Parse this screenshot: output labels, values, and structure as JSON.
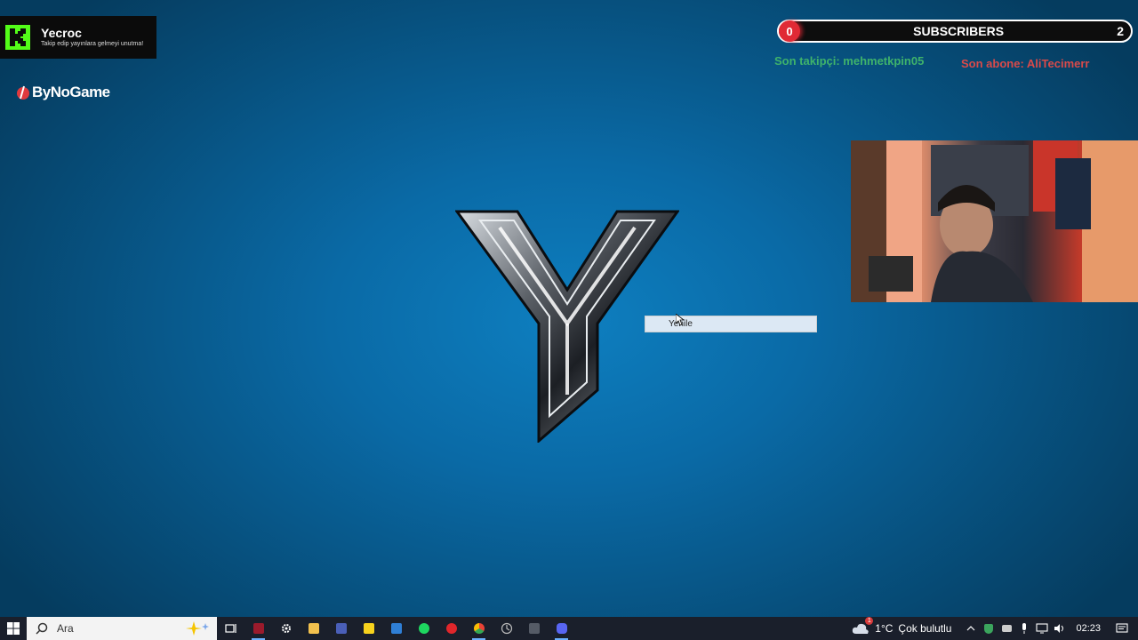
{
  "overlay": {
    "kick_name": "Yecroc",
    "kick_sub": "Takip edip yayınlara gelmeyi unutma!",
    "sponsor": "ByNoGame",
    "subs_current": "0",
    "subs_label": "SUBSCRIBERS",
    "subs_goal": "2",
    "last_follower": "Son takipçi: mehmetkpin05",
    "last_subscriber": "Son abone: AliTecimerr",
    "accent_kick": "#53fc18",
    "accent_red": "#e02a35"
  },
  "context_menu": {
    "items": [
      "Yenile"
    ]
  },
  "taskbar": {
    "search_placeholder": "Ara",
    "apps": [
      "task-view",
      "kick-app",
      "settings",
      "file-explorer",
      "app-blue",
      "sticky-notes",
      "mail",
      "spotify",
      "opera",
      "chrome",
      "clock-app",
      "calculator",
      "discord"
    ],
    "weather_temp": "1°C",
    "weather_desc": "Çok bulutlu",
    "weather_badge": "1",
    "time": "02:23"
  }
}
